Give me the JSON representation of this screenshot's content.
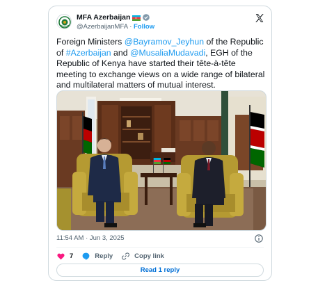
{
  "tweet": {
    "author_name": "MFA Azerbaijan",
    "author_flag": "azerbaijan-flag-emoji",
    "verified_badge": "verified-icon",
    "handle": "@AzerbaijanMFA",
    "separator": "·",
    "follow_label": "Follow",
    "text": {
      "p1": "Foreign Ministers ",
      "mention1": "@Bayramov_Jeyhun",
      "p2": " of the Republic of ",
      "hashtag": "#Azerbaijan",
      "p3": " and ",
      "mention2": "@MusaliaMudavadi",
      "p4": ", EGH of the Republic of Kenya have started their tête-à-tête meeting to exchange views on a wide range of bilateral and multilateral matters of mutual interest."
    },
    "timestamp": "11:54 AM · Jun 3, 2025",
    "actions": {
      "like_count": "7",
      "reply_label": "Reply",
      "copy_label": "Copy link"
    },
    "read_replies_label": "Read 1 reply"
  },
  "colors": {
    "link": "#1d9bf0",
    "text": "#0f1419",
    "muted": "#536471",
    "like": "#f91880",
    "border": "#cfd9de"
  },
  "icons": [
    "x-logo-icon",
    "verified-icon",
    "heart-icon",
    "reply-icon",
    "link-icon",
    "info-icon"
  ]
}
